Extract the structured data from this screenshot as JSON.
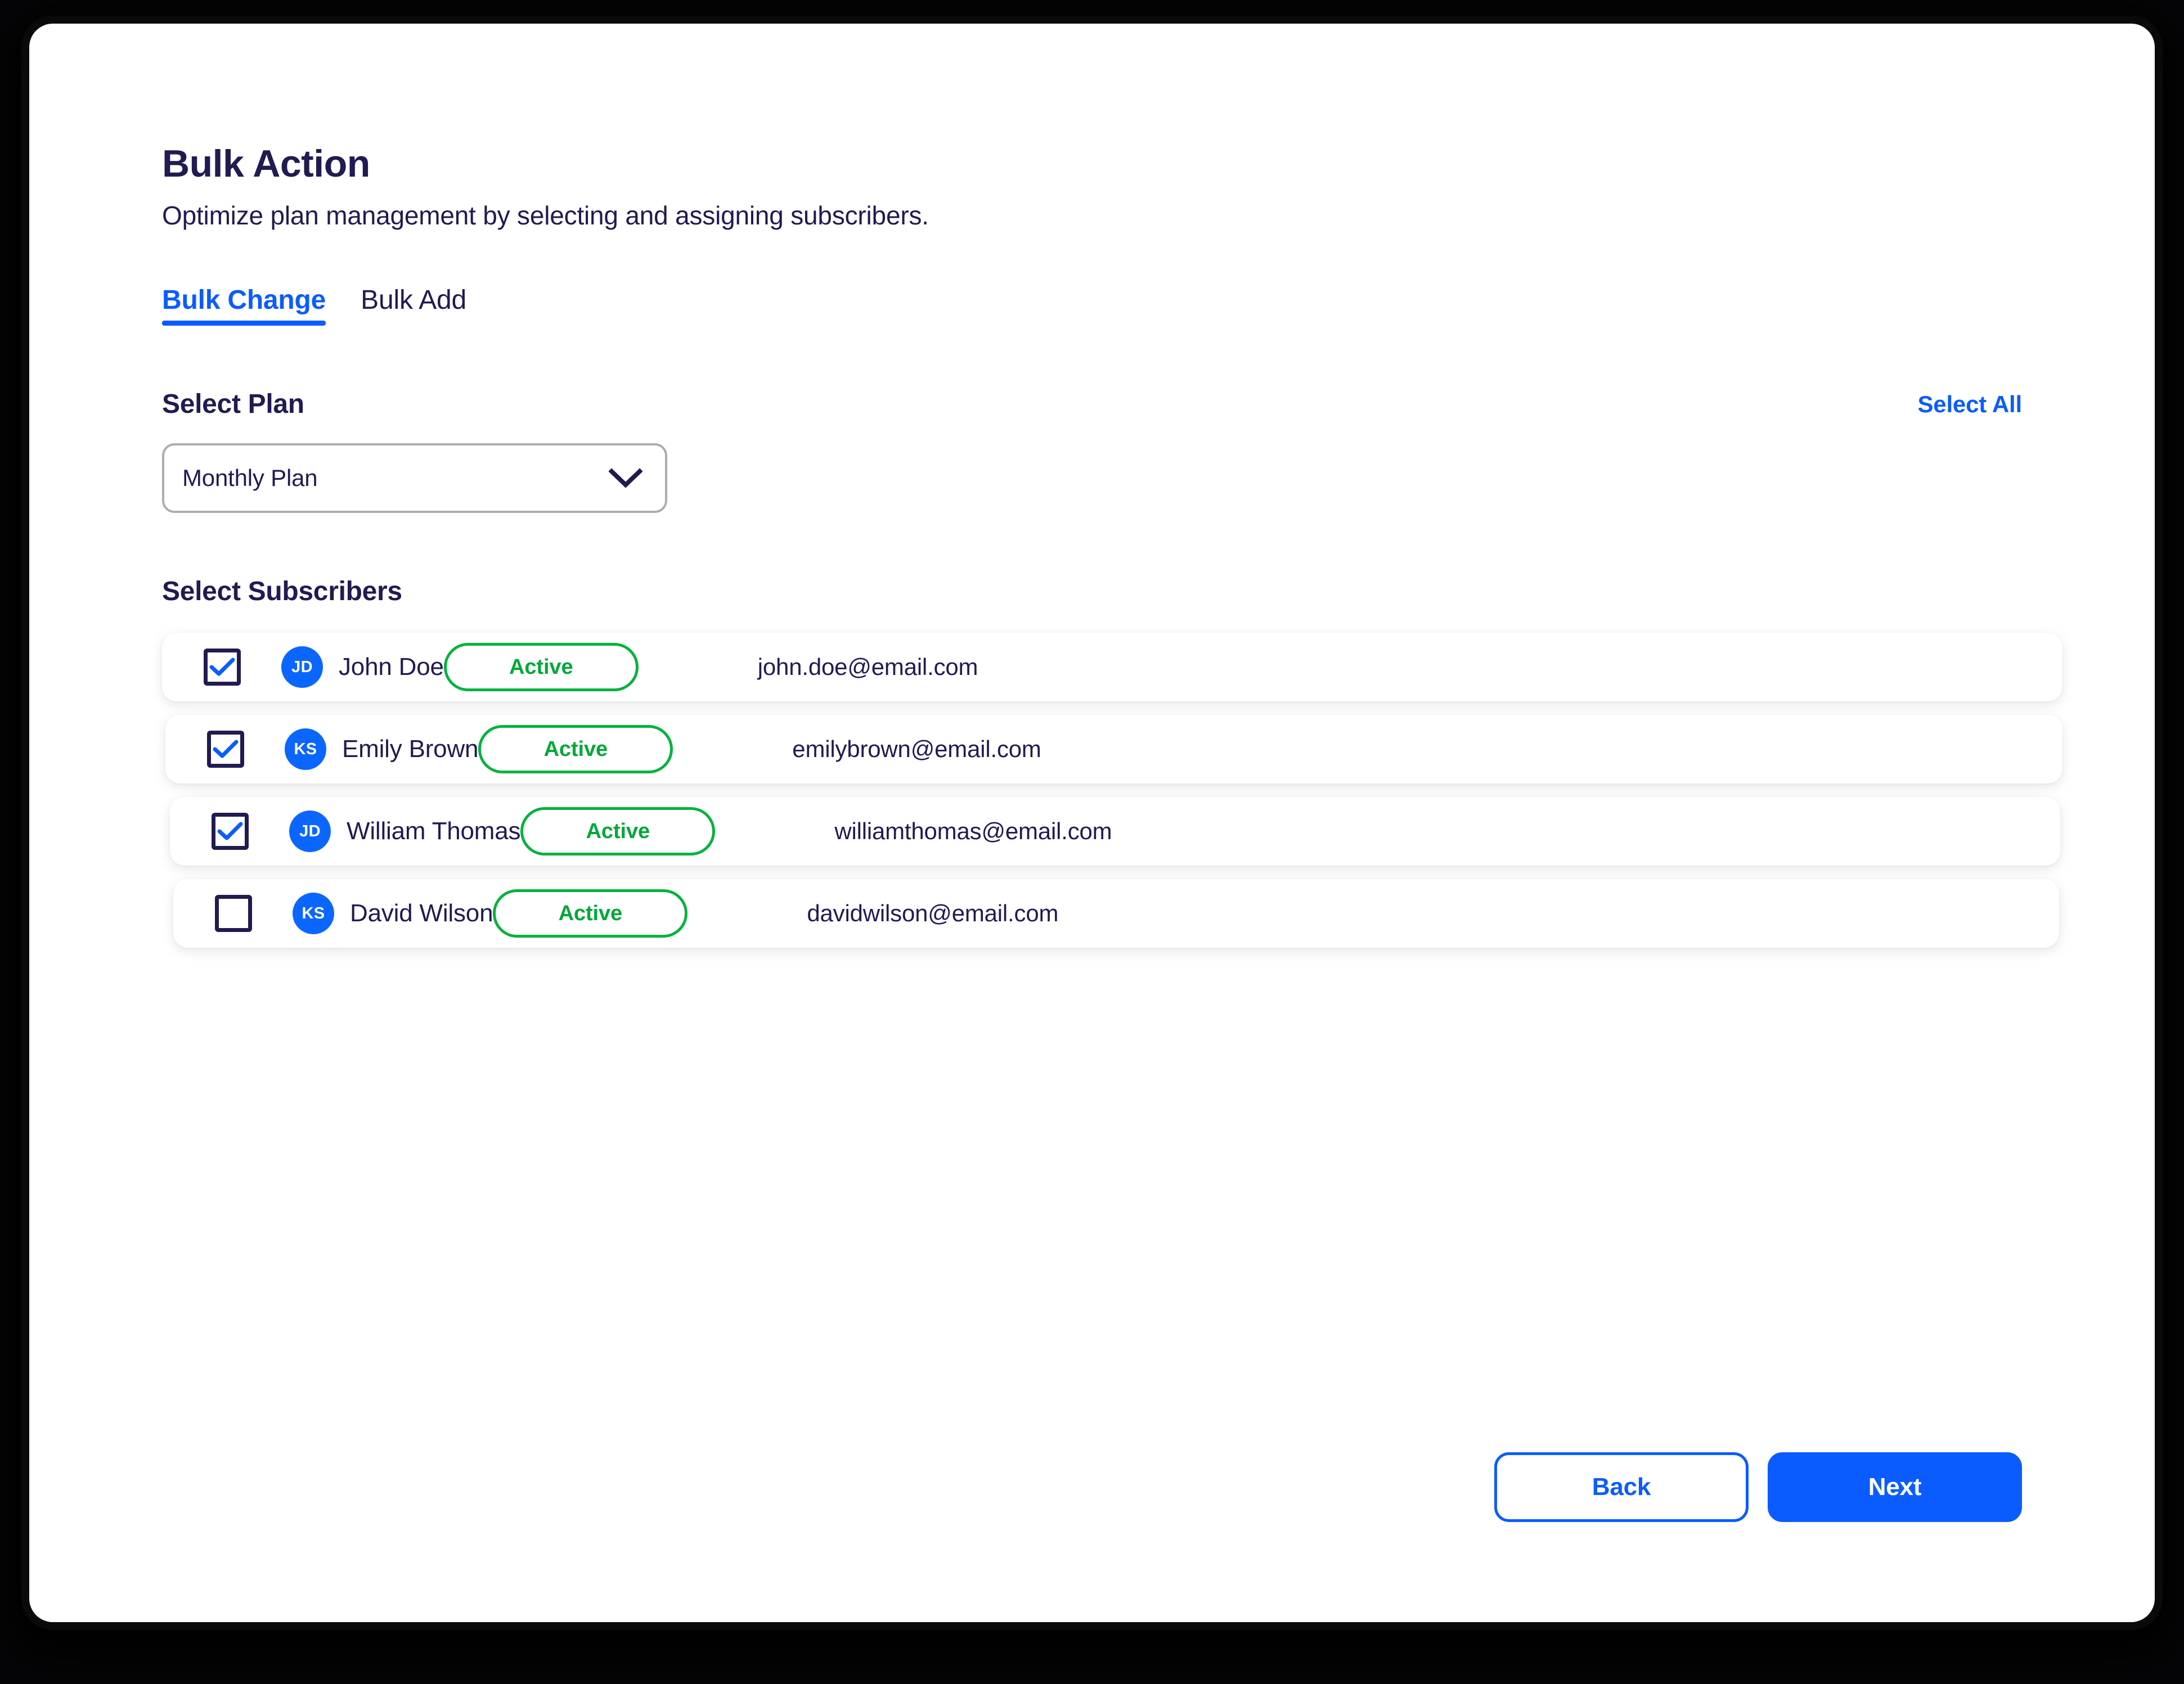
{
  "header": {
    "title": "Bulk Action",
    "subtitle": "Optimize plan management by selecting and assigning subscribers."
  },
  "tabs": [
    {
      "label": "Bulk Change",
      "active": true
    },
    {
      "label": "Bulk Add",
      "active": false
    }
  ],
  "plan_section": {
    "label": "Select Plan",
    "select_all_label": "Select All",
    "selected_value": "Monthly Plan",
    "chevron_icon": "chevron-down-icon"
  },
  "subscribers_section": {
    "label": "Select Subscribers",
    "rows": [
      {
        "checked": true,
        "initials": "JD",
        "name": "John Doe",
        "status": "Active",
        "email": "john.doe@email.com"
      },
      {
        "checked": true,
        "initials": "KS",
        "name": "Emily Brown",
        "status": "Active",
        "email": "emilybrown@email.com"
      },
      {
        "checked": true,
        "initials": "JD",
        "name": "William Thomas",
        "status": "Active",
        "email": "williamthomas@email.com"
      },
      {
        "checked": false,
        "initials": "KS",
        "name": "David Wilson",
        "status": "Active",
        "email": "davidwilson@email.com"
      }
    ]
  },
  "footer": {
    "back_label": "Back",
    "next_label": "Next"
  },
  "colors": {
    "accent_blue": "#0B5CFF",
    "avatar_blue": "#0B66FF",
    "status_green": "#00B33C",
    "text_navy": "#201B51",
    "border_gray": "#ADADAD"
  }
}
